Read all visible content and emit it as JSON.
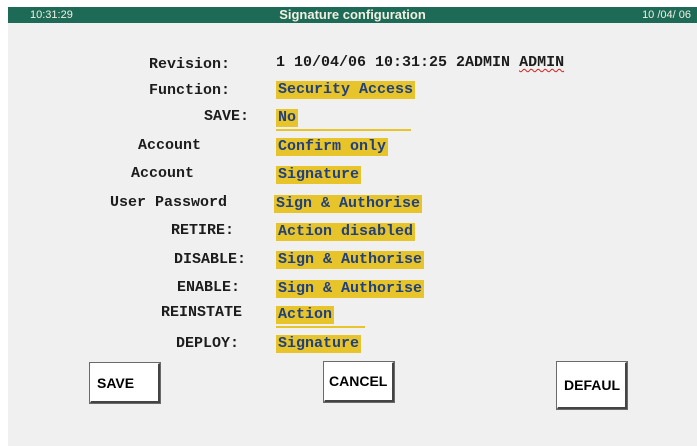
{
  "header": {
    "time": "10:31:29",
    "title": "Signature configuration",
    "date": "10 /04/ 06"
  },
  "form": {
    "revision": {
      "label": "Revision:",
      "value": "1 10/04/06 10:31:25 2ADMIN",
      "user": "ADMIN"
    },
    "function": {
      "label": "Function:",
      "value": "Security Access"
    },
    "save": {
      "label": "SAVE:",
      "value": "No"
    },
    "account_1": {
      "label": "Account",
      "value": "Confirm only"
    },
    "account_2": {
      "label": "Account",
      "value": "Signature"
    },
    "user_password": {
      "label": "User Password",
      "value": "Sign & Authorise"
    },
    "retire": {
      "label": "RETIRE:",
      "value": "Action disabled"
    },
    "disable": {
      "label": "DISABLE:",
      "value": "Sign & Authorise"
    },
    "enable": {
      "label": "ENABLE:",
      "value": "Sign & Authorise"
    },
    "reinstate": {
      "label": "REINSTATE",
      "value": "Action"
    },
    "deploy": {
      "label": "DEPLOY:",
      "value": "Signature"
    }
  },
  "buttons": {
    "save": "SAVE",
    "cancel": "CANCEL",
    "default": "DEFAUL"
  },
  "colors": {
    "titlebar": "#1d6b56",
    "value_highlight": "#e7c42a",
    "value_text": "#20407f",
    "panel": "#f0f0f0"
  }
}
